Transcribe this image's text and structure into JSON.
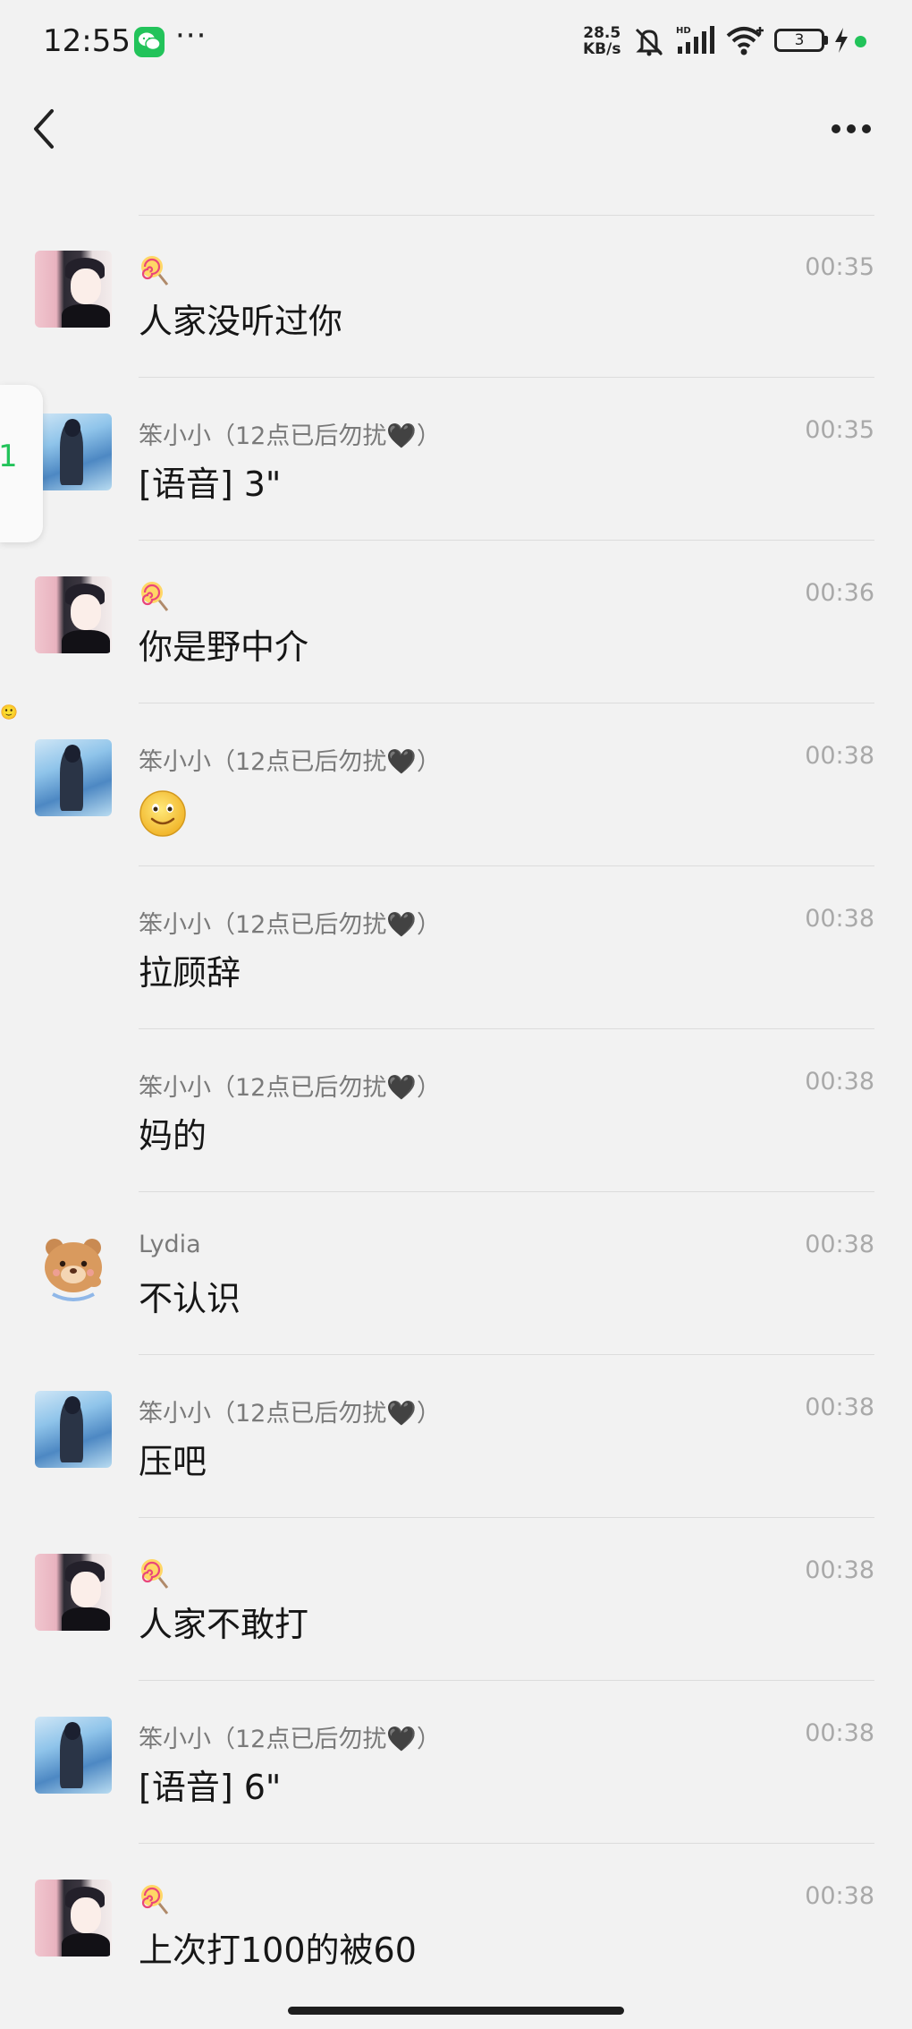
{
  "status_bar": {
    "time": "12:55",
    "dots": "···",
    "net_speed_value": "28.5",
    "net_speed_unit": "KB/s",
    "battery_level": "3"
  },
  "nav": {
    "back_icon": "chevron-left-icon",
    "more_icon": "more-dots-icon"
  },
  "side_tab": {
    "label": "1"
  },
  "messages": [
    {
      "sender": "🍭",
      "time": "00:35",
      "text": "人家没听过你"
    },
    {
      "sender": "笨小小（12点已后勿扰🖤）",
      "time": "00:35",
      "text": "[语音] 3\""
    },
    {
      "sender": "🍭",
      "time": "00:36",
      "text": "你是野中介"
    },
    {
      "sender": "笨小小（12点已后勿扰🖤）",
      "time": "00:38",
      "text": "🙂"
    },
    {
      "sender": "笨小小（12点已后勿扰🖤）",
      "time": "00:38",
      "text": "拉顾辞"
    },
    {
      "sender": "笨小小（12点已后勿扰🖤）",
      "time": "00:38",
      "text": "妈的"
    },
    {
      "sender": "Lydia",
      "time": "00:38",
      "text": "不认识"
    },
    {
      "sender": "笨小小（12点已后勿扰🖤）",
      "time": "00:38",
      "text": "压吧"
    },
    {
      "sender": "🍭",
      "time": "00:38",
      "text": "人家不敢打"
    },
    {
      "sender": "笨小小（12点已后勿扰🖤）",
      "time": "00:38",
      "text": "[语音] 6\""
    },
    {
      "sender": "🍭",
      "time": "00:38",
      "text": "上次打100的被60"
    }
  ],
  "colors": {
    "background": "#f2f2f2",
    "wechat_green": "#22c35a",
    "name_gray": "#7a7a7a",
    "time_gray": "#a9a9a9"
  }
}
